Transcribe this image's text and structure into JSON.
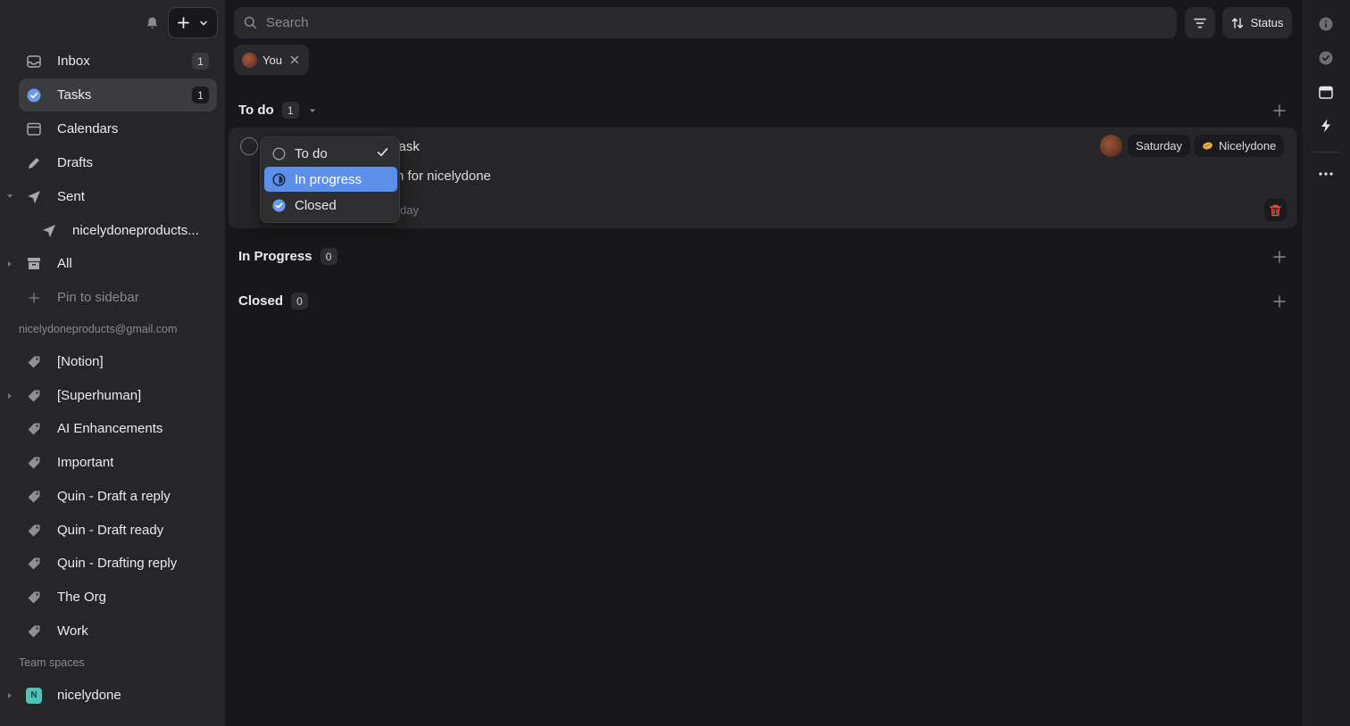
{
  "sidebar": {
    "items": [
      {
        "label": "Inbox",
        "badge": "1"
      },
      {
        "label": "Tasks",
        "badge": "1"
      },
      {
        "label": "Calendars"
      },
      {
        "label": "Drafts"
      },
      {
        "label": "Sent"
      },
      {
        "label": "nicelydoneproducts..."
      },
      {
        "label": "All"
      },
      {
        "label": "Pin to sidebar"
      }
    ],
    "account_email": "nicelydoneproducts@gmail.com",
    "labels": [
      "[Notion]",
      "[Superhuman]",
      "AI Enhancements",
      "Important",
      "Quin - Draft a reply",
      "Quin - Draft ready",
      "Quin - Drafting reply",
      "The Org",
      "Work"
    ],
    "team_spaces_heading": "Team spaces",
    "workspace": {
      "initial": "N",
      "name": "nicelydone"
    }
  },
  "search": {
    "placeholder": "Search"
  },
  "toolbar": {
    "sort_label": "Status"
  },
  "filter_chip": {
    "label": "You"
  },
  "groups": [
    {
      "title": "To do",
      "count": "1"
    },
    {
      "title": "In Progress",
      "count": "0"
    },
    {
      "title": "Closed",
      "count": "0"
    }
  ],
  "task": {
    "title_visible": "Task",
    "description_visible": "n for nicelydone",
    "meta_visible": "day",
    "due": "Saturday",
    "workspace_tag": "Nicelydone"
  },
  "status_menu": {
    "options": [
      {
        "label": "To do",
        "selected": true
      },
      {
        "label": "In progress",
        "highlighted": true
      },
      {
        "label": "Closed"
      }
    ]
  },
  "colors": {
    "accent": "#5c8fea",
    "sidebar_bg": "#262628",
    "main_bg": "#18181a",
    "danger": "#e5534b",
    "workspace_avatar": "#4ec3b7"
  }
}
